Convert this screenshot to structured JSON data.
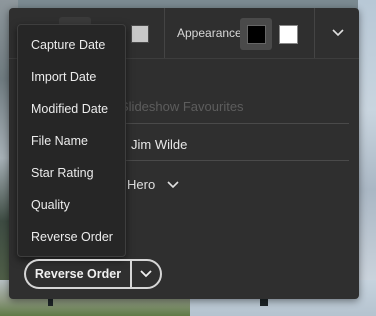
{
  "toolbar": {
    "appearance_label": "Appearance",
    "swatches": {
      "gray": "#c8c8c8",
      "black": "#000000",
      "white": "#ffffff"
    },
    "menu_icon": "chevron-down-icon"
  },
  "form": {
    "title_placeholder": "Slideshow Favourites",
    "author_value": "Jim Wilde",
    "layout_value": "Hero",
    "layout_icon": "chevron-down-icon"
  },
  "sort_menu": {
    "items": [
      "Capture Date",
      "Import Date",
      "Modified Date",
      "File Name",
      "Star Rating",
      "Quality",
      "Reverse Order"
    ]
  },
  "sort_button": {
    "label": "Reverse Order",
    "icon": "chevron-down-icon"
  }
}
